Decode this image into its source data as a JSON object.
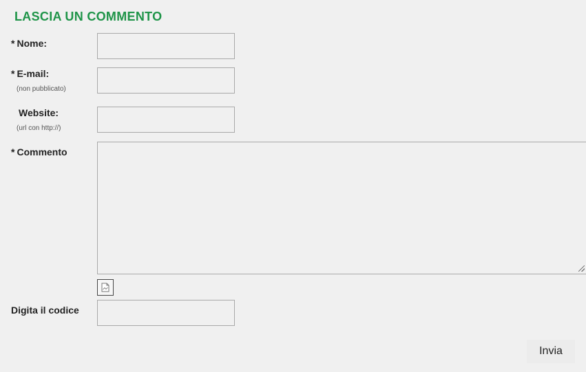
{
  "form": {
    "title": "LASCIA UN COMMENTO",
    "required_marker": "*",
    "name_label": "Nome:",
    "email_label": "E-mail:",
    "email_note": "(non pubblicato)",
    "website_label": "Website:",
    "website_note": "(url con http://)",
    "comment_label": "Commento",
    "captcha_label": "Digita il codice",
    "submit_label": "Invia"
  },
  "colors": {
    "title": "#1e9448",
    "background": "#f0f0f0",
    "field_border": "#a8a8a8"
  },
  "icons": {
    "captcha": "captcha-image-icon"
  }
}
